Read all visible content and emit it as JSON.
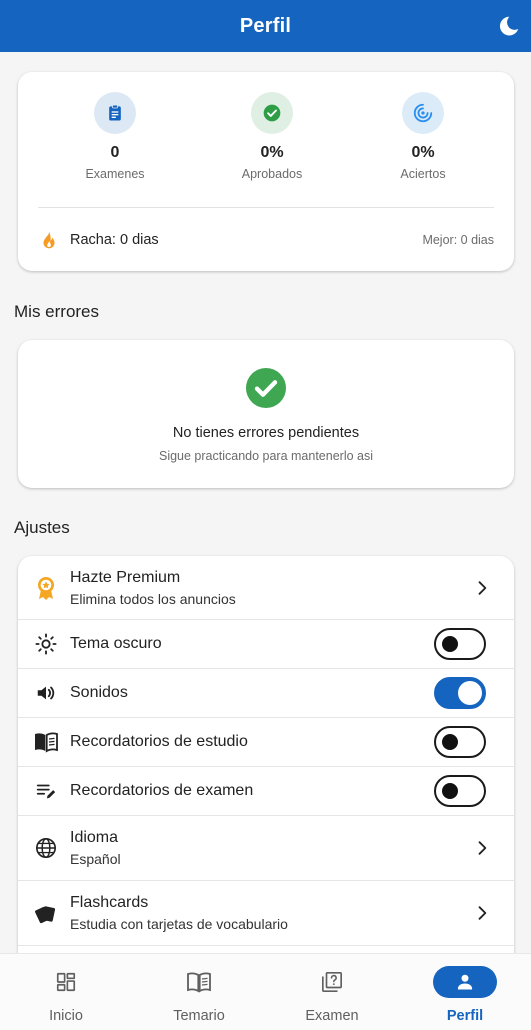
{
  "app_bar": {
    "title": "Perfil",
    "theme_icon": "moon-icon"
  },
  "stats": {
    "items": [
      {
        "value": "0",
        "label": "Examenes",
        "icon": "clipboard-icon",
        "color": "#1565c0",
        "bg": "#dde8f5"
      },
      {
        "value": "0%",
        "label": "Aprobados",
        "icon": "check-circle-icon",
        "color": "#2e9e46",
        "bg": "#e0efe3"
      },
      {
        "value": "0%",
        "label": "Aciertos",
        "icon": "target-icon",
        "color": "#2a8ff0",
        "bg": "#dcebf8"
      }
    ],
    "streak": "Racha: 0 dias",
    "best": "Mejor: 0 dias",
    "streak_color": "#f59a23"
  },
  "errors": {
    "section_title": "Mis errores",
    "title": "No tienes errores pendientes",
    "subtitle": "Sigue practicando para mantenerlo asi",
    "check_color": "#3fa752"
  },
  "settings": {
    "section_title": "Ajustes",
    "premium": {
      "title": "Hazte Premium",
      "subtitle": "Elimina todos los anuncios"
    },
    "dark_theme": {
      "label": "Tema oscuro",
      "enabled": false
    },
    "sounds": {
      "label": "Sonidos",
      "enabled": true
    },
    "study_reminders": {
      "label": "Recordatorios de estudio",
      "enabled": false
    },
    "exam_reminders": {
      "label": "Recordatorios de examen",
      "enabled": false
    },
    "language": {
      "title": "Idioma",
      "subtitle": "Español"
    },
    "flashcards": {
      "title": "Flashcards",
      "subtitle": "Estudia con tarjetas de vocabulario"
    }
  },
  "bottom_nav": {
    "items": [
      {
        "label": "Inicio",
        "icon": "dashboard-icon",
        "active": false
      },
      {
        "label": "Temario",
        "icon": "book-icon",
        "active": false
      },
      {
        "label": "Examen",
        "icon": "quiz-icon",
        "active": false
      },
      {
        "label": "Perfil",
        "icon": "person-icon",
        "active": true
      }
    ]
  },
  "colors": {
    "primary": "#1565c0",
    "background": "#f5f5f5"
  }
}
